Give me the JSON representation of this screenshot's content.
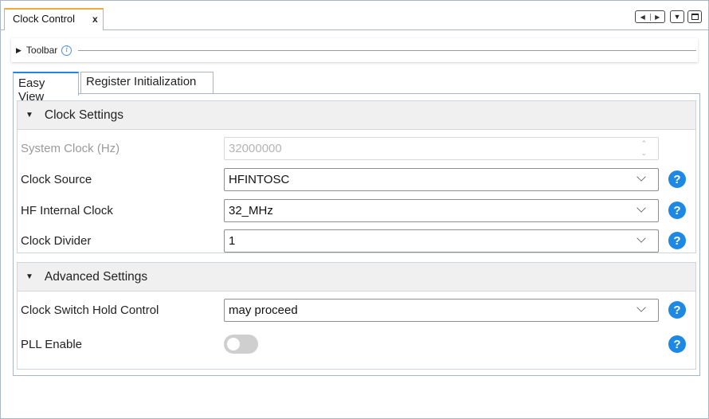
{
  "tab": {
    "title": "Clock Control",
    "close": "x"
  },
  "window_controls": {
    "prev": "◀",
    "next": "▶",
    "menu": "▼"
  },
  "toolbar": {
    "label": "Toolbar",
    "info": "i"
  },
  "view_tabs": [
    {
      "label": "Easy View",
      "active": true
    },
    {
      "label": "Register Initialization",
      "active": false
    }
  ],
  "clock_settings": {
    "title": "Clock Settings",
    "rows": [
      {
        "label": "System Clock (Hz)",
        "value": "32000000",
        "type": "spinner",
        "disabled": true,
        "help": false
      },
      {
        "label": "Clock Source",
        "value": "HFINTOSC",
        "type": "dropdown",
        "help": "?"
      },
      {
        "label": "HF Internal Clock",
        "value": "32_MHz",
        "type": "dropdown",
        "help": "?"
      },
      {
        "label": "Clock Divider",
        "value": "1",
        "type": "dropdown",
        "help": "?"
      }
    ]
  },
  "advanced_settings": {
    "title": "Advanced Settings",
    "rows": [
      {
        "label": "Clock Switch Hold Control",
        "value": "may proceed",
        "type": "dropdown",
        "help": "?"
      },
      {
        "label": "PLL Enable",
        "type": "toggle",
        "on": false,
        "help": "?"
      }
    ]
  },
  "colors": {
    "accent": "#1e88e5",
    "tab_highlight": "#f2a93b",
    "section_bg": "#f0f0f0"
  }
}
